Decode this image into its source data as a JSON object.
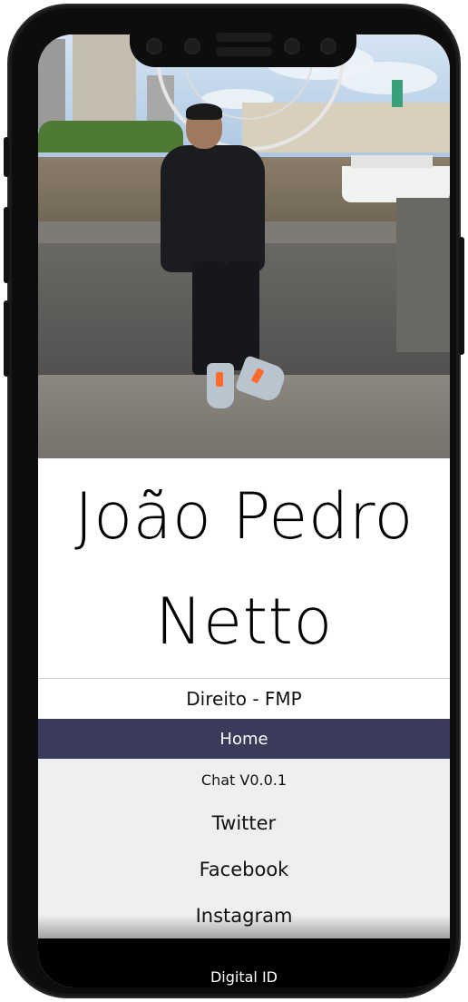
{
  "profile": {
    "name_line1": "João Pedro",
    "name_line2": "Netto",
    "course": "Direito - FMP"
  },
  "nav": {
    "active": "Home",
    "items": [
      {
        "label": "Home"
      },
      {
        "label": "Chat V0.0.1"
      },
      {
        "label": "Twitter"
      },
      {
        "label": "Facebook"
      },
      {
        "label": "Instagram"
      }
    ]
  },
  "footer": {
    "label": "Digital ID"
  },
  "colors": {
    "nav_active_bg": "#3a3a5a",
    "nav_bg": "#efefef",
    "footer_bg": "#000000",
    "phone_frame": "#0d0d0d"
  },
  "icons": [
    "notch-camera-icon",
    "notch-speaker-icon"
  ]
}
